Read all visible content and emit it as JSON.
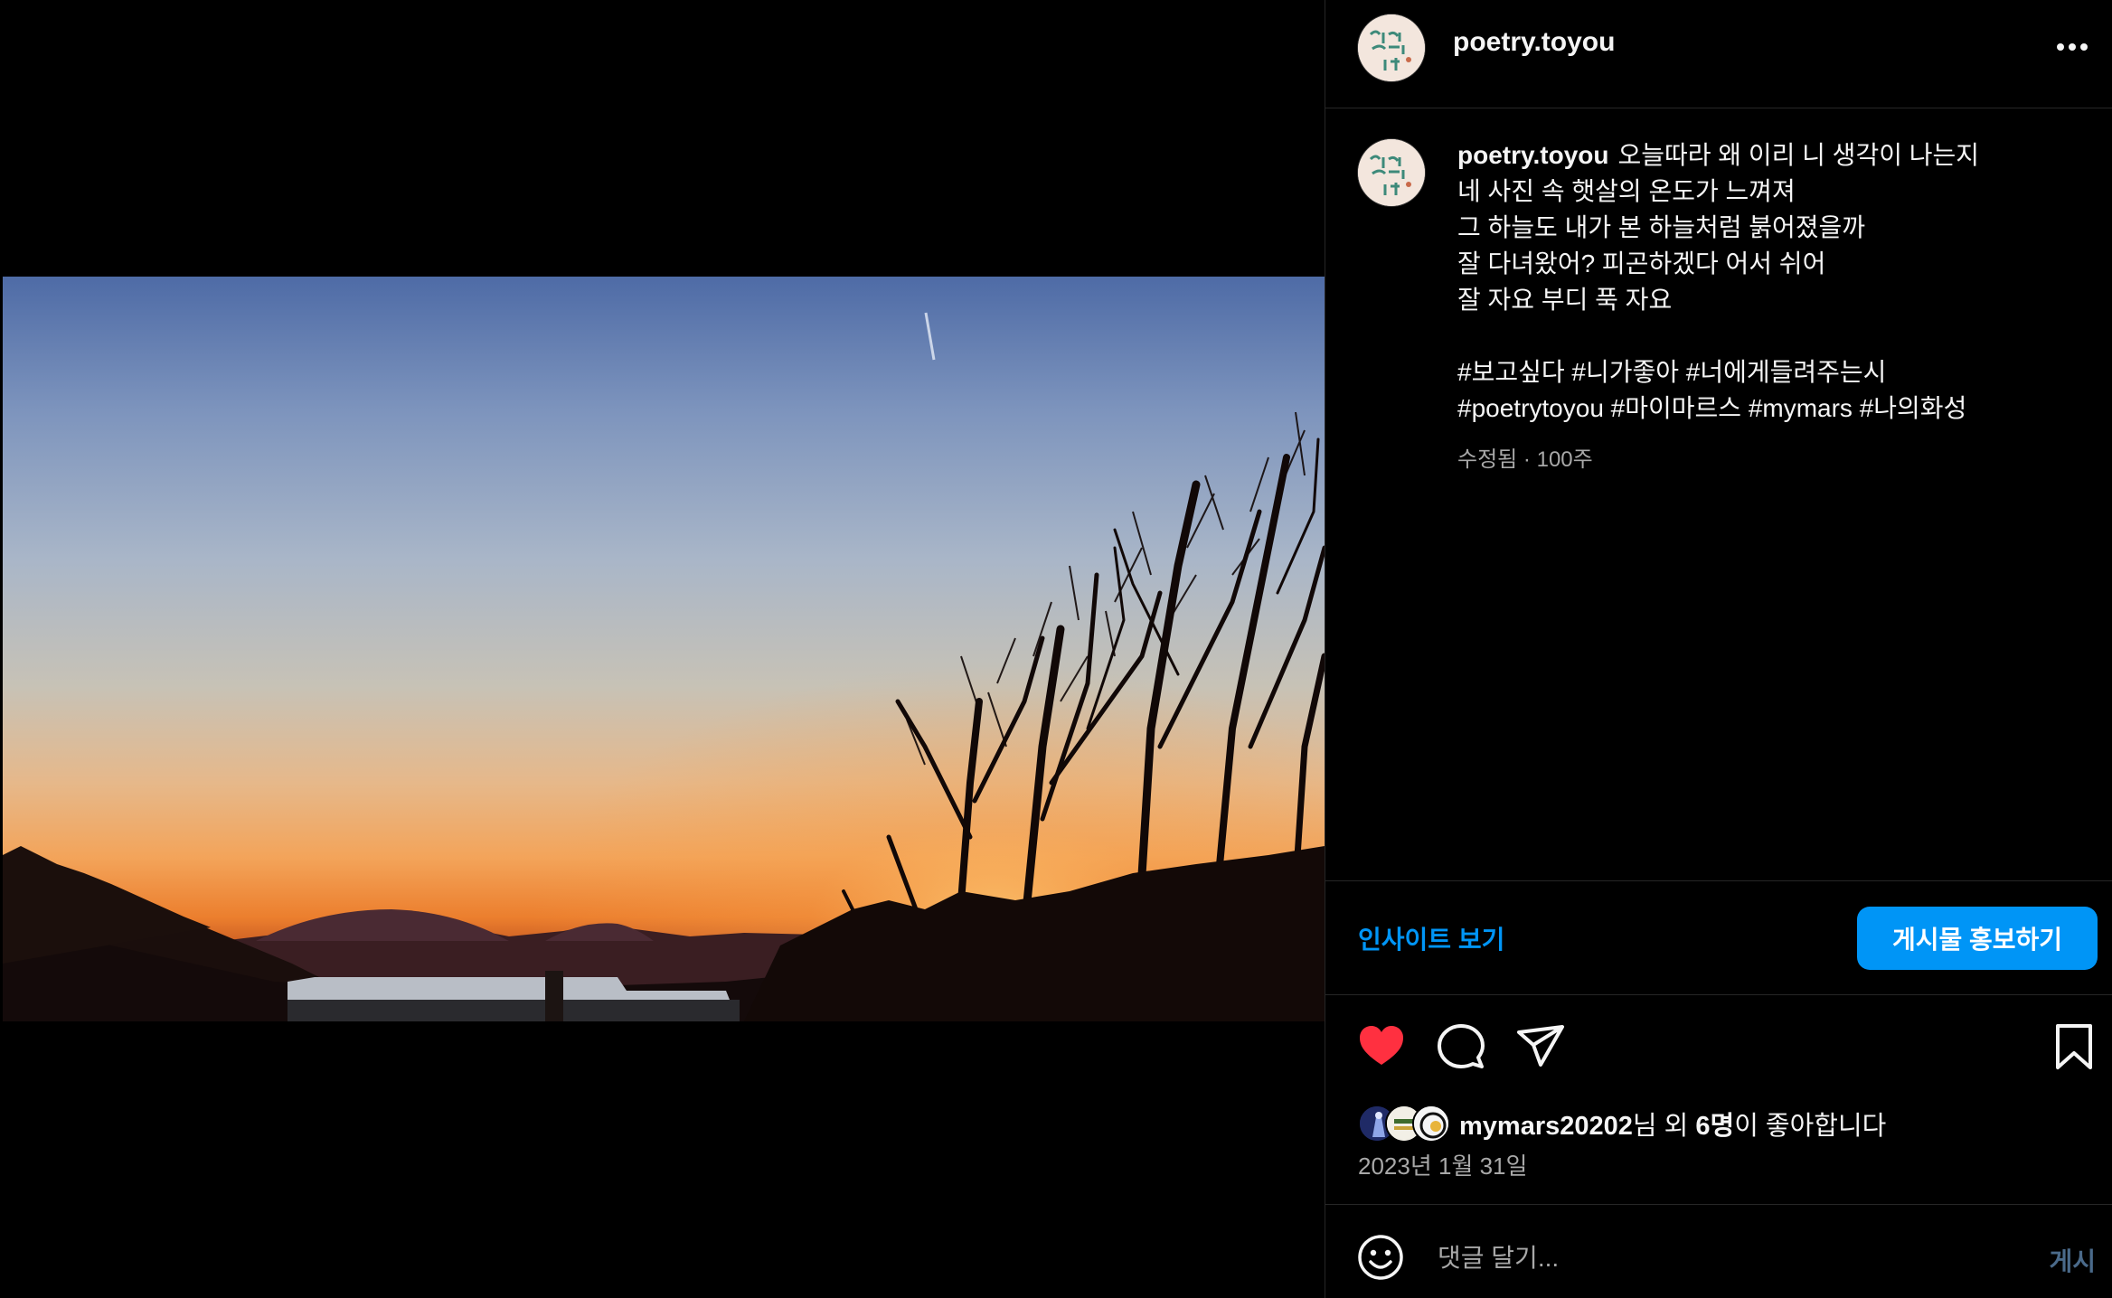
{
  "post": {
    "username": "poetry.toyou",
    "caption_lines": [
      "오늘따라 왜 이리 니 생각이 나는지",
      "네 사진 속 햇살의 온도가 느껴져",
      "그 하늘도 내가 본 하늘처럼 붉어졌을까",
      "잘 다녀왔어? 피곤하겠다 어서 쉬어",
      "잘 자요 부디 푹 자요"
    ],
    "hashtag_lines": [
      "#보고싶다 #니가좋아 #너에게들려주는시",
      "#poetrytoyou #마이마르스 #mymars #나의화성"
    ],
    "edited_label": "수정됨",
    "separator": "·",
    "age": "100주",
    "avatar_text": "너에게 들려주는 시"
  },
  "actions": {
    "insights": "인사이트 보기",
    "boost": "게시물 홍보하기",
    "like_icon": "heart-filled-icon",
    "comment_icon": "comment-icon",
    "share_icon": "send-icon",
    "save_icon": "bookmark-icon"
  },
  "likes": {
    "liker": "mymars20202",
    "suffix_before_count": "님 외 ",
    "count": "6명",
    "suffix": "이 좋아합니다"
  },
  "date": "2023년 1월 31일",
  "comment": {
    "placeholder": "댓글 달기...",
    "post_label": "게시"
  },
  "colors": {
    "accent": "#0095f6",
    "like": "#ff3040",
    "muted_text": "#a8a8a8",
    "divider": "#262626"
  }
}
